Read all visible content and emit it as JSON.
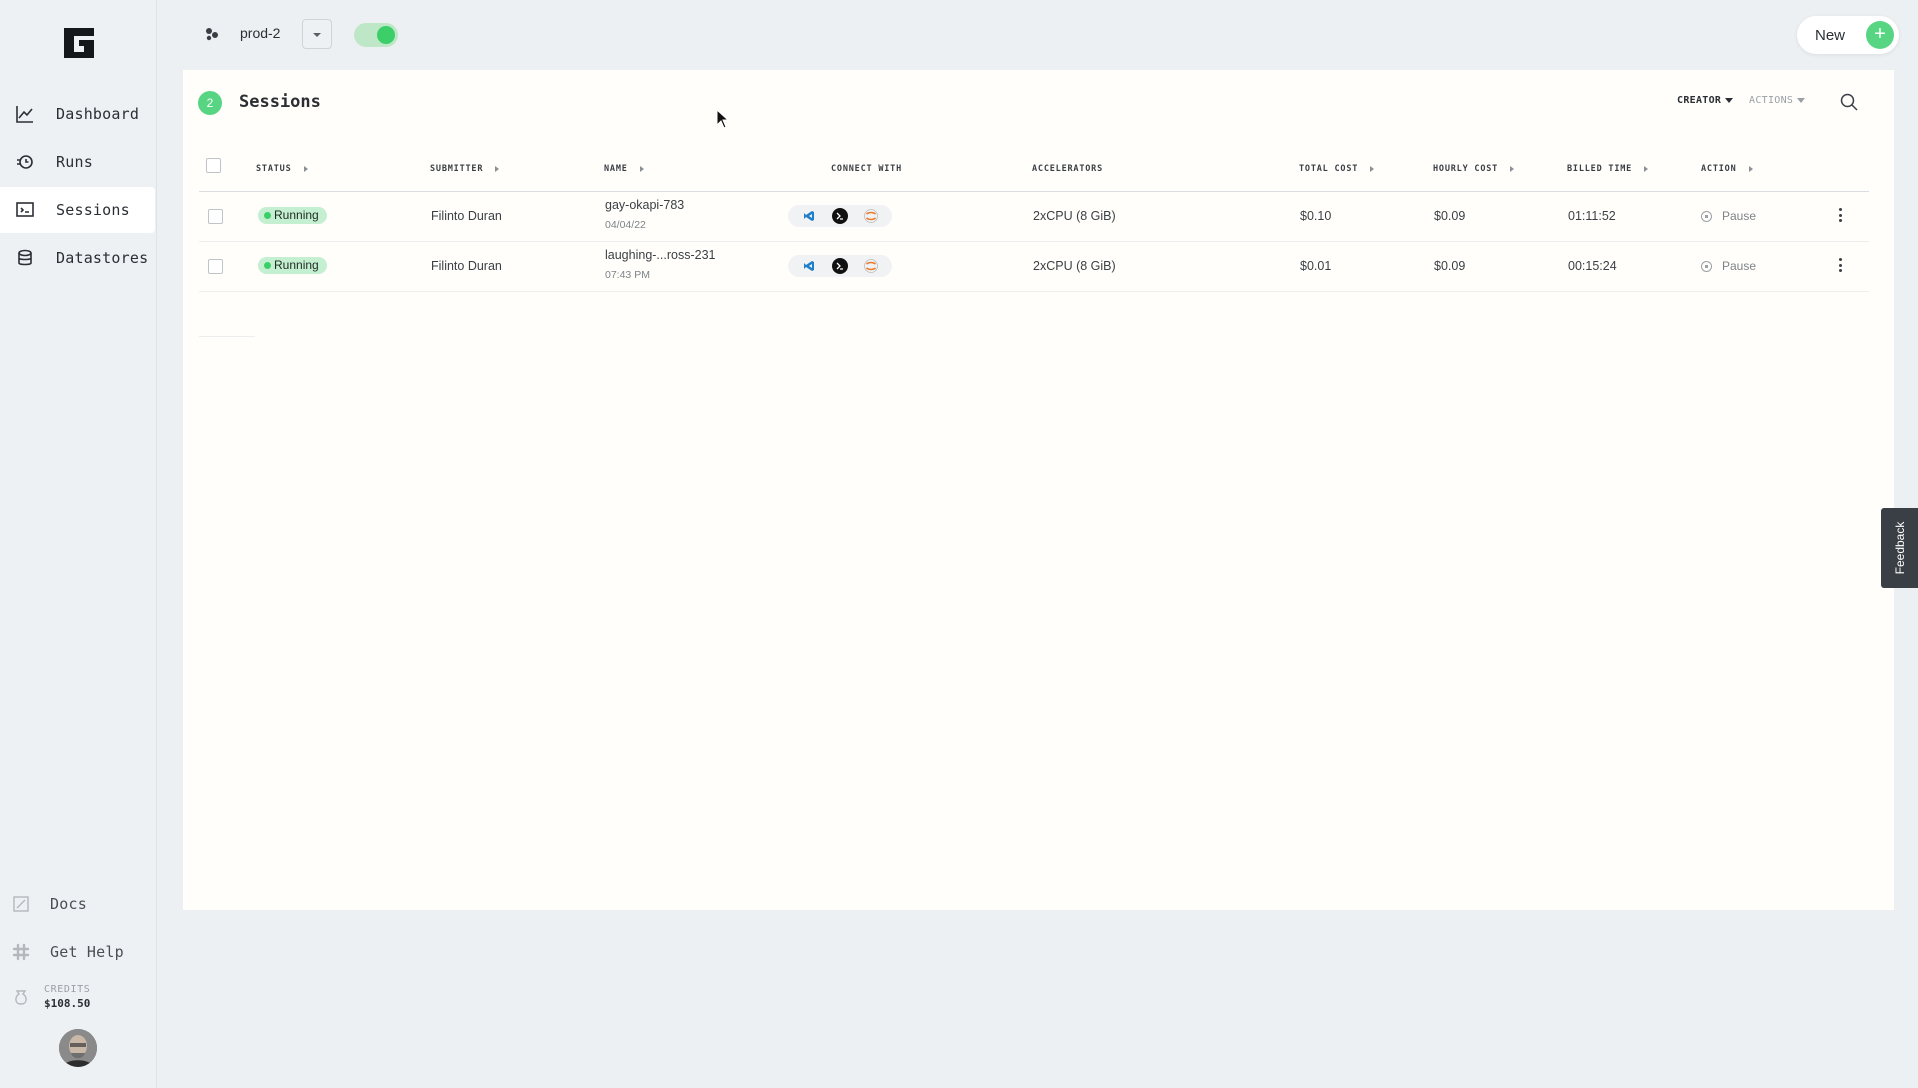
{
  "sidebar": {
    "items": [
      {
        "label": "Dashboard",
        "icon": "chart-line-icon",
        "active": false
      },
      {
        "label": "Runs",
        "icon": "runs-icon",
        "active": false
      },
      {
        "label": "Sessions",
        "icon": "sessions-icon",
        "active": true
      },
      {
        "label": "Datastores",
        "icon": "database-icon",
        "active": false
      }
    ],
    "bottom": [
      {
        "label": "Docs",
        "icon": "docs-icon"
      },
      {
        "label": "Get Help",
        "icon": "slack-icon"
      }
    ],
    "credits": {
      "label": "CREDITS",
      "value": "$108.50"
    }
  },
  "topbar": {
    "project": "prod-2",
    "new_label": "New",
    "new_icon": "plus-icon"
  },
  "panel": {
    "count": "2",
    "title": "Sessions",
    "filters": {
      "creator": "CREATOR",
      "actions": "ACTIONS"
    }
  },
  "table": {
    "headers": {
      "status": "STATUS",
      "submitter": "SUBMITTER",
      "name": "NAME",
      "connect": "CONNECT WITH",
      "accelerators": "ACCELERATORS",
      "total_cost": "TOTAL COST",
      "hourly_cost": "HOURLY COST",
      "billed_time": "BILLED TIME",
      "action": "ACTION"
    },
    "rows": [
      {
        "status": "Running",
        "submitter": "Filinto Duran",
        "name": "gay-okapi-783",
        "date": "04/04/22",
        "accelerators": "2xCPU (8 GiB)",
        "total_cost": "$0.10",
        "hourly_cost": "$0.09",
        "billed_time": "01:11:52",
        "action": "Pause"
      },
      {
        "status": "Running",
        "submitter": "Filinto Duran",
        "name": "laughing-...ross-231",
        "date": "07:43 PM",
        "accelerators": "2xCPU (8 GiB)",
        "total_cost": "$0.01",
        "hourly_cost": "$0.09",
        "billed_time": "00:15:24",
        "action": "Pause"
      }
    ]
  },
  "feedback": "Feedback",
  "colors": {
    "accent_green": "#57d583",
    "running_badge": "#c5efd1",
    "panel_bg": "#fffefa",
    "page_bg": "#edf0f3"
  }
}
